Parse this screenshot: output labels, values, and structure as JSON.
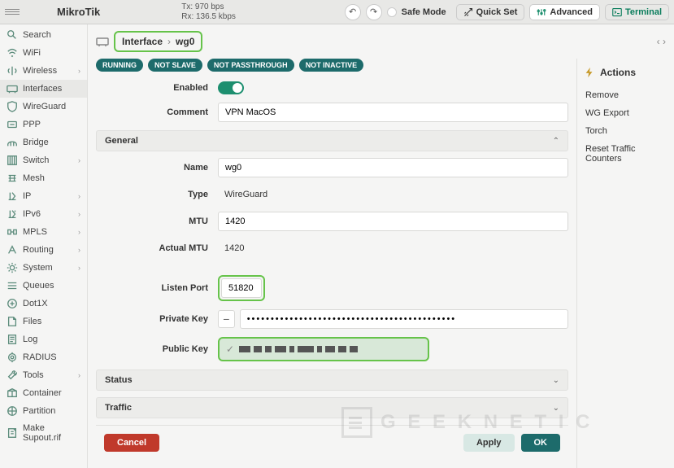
{
  "brand": "MikroTik",
  "stats": {
    "tx": "Tx: 970 bps",
    "rx": "Rx: 136.5 kbps"
  },
  "top": {
    "safemode": "Safe Mode",
    "quickset": "Quick Set",
    "advanced": "Advanced",
    "terminal": "Terminal"
  },
  "sidebar": [
    {
      "label": "Search",
      "icon": "search",
      "chev": false
    },
    {
      "label": "WiFi",
      "icon": "wifi",
      "chev": false
    },
    {
      "label": "Wireless",
      "icon": "wireless",
      "chev": true
    },
    {
      "label": "Interfaces",
      "icon": "interfaces",
      "chev": false,
      "sel": true
    },
    {
      "label": "WireGuard",
      "icon": "shield",
      "chev": false
    },
    {
      "label": "PPP",
      "icon": "ppp",
      "chev": false
    },
    {
      "label": "Bridge",
      "icon": "bridge",
      "chev": false
    },
    {
      "label": "Switch",
      "icon": "switch",
      "chev": true
    },
    {
      "label": "Mesh",
      "icon": "mesh",
      "chev": false
    },
    {
      "label": "IP",
      "icon": "ip",
      "chev": true
    },
    {
      "label": "IPv6",
      "icon": "ipv6",
      "chev": true
    },
    {
      "label": "MPLS",
      "icon": "mpls",
      "chev": true
    },
    {
      "label": "Routing",
      "icon": "routing",
      "chev": true
    },
    {
      "label": "System",
      "icon": "system",
      "chev": true
    },
    {
      "label": "Queues",
      "icon": "queues",
      "chev": false
    },
    {
      "label": "Dot1X",
      "icon": "dot1x",
      "chev": false
    },
    {
      "label": "Files",
      "icon": "files",
      "chev": false
    },
    {
      "label": "Log",
      "icon": "log",
      "chev": false
    },
    {
      "label": "RADIUS",
      "icon": "radius",
      "chev": false
    },
    {
      "label": "Tools",
      "icon": "tools",
      "chev": true
    },
    {
      "label": "Container",
      "icon": "container",
      "chev": false
    },
    {
      "label": "Partition",
      "icon": "partition",
      "chev": false
    },
    {
      "label": "Make Supout.rif",
      "icon": "supout",
      "chev": false
    }
  ],
  "breadcrumb": {
    "parent": "Interface",
    "current": "wg0"
  },
  "badges": [
    "RUNNING",
    "NOT SLAVE",
    "NOT PASSTHROUGH",
    "NOT INACTIVE"
  ],
  "fields": {
    "enabled_label": "Enabled",
    "comment_label": "Comment",
    "comment_value": "VPN MacOS",
    "name_label": "Name",
    "name_value": "wg0",
    "type_label": "Type",
    "type_value": "WireGuard",
    "mtu_label": "MTU",
    "mtu_value": "1420",
    "actual_mtu_label": "Actual MTU",
    "actual_mtu_value": "1420",
    "listen_port_label": "Listen Port",
    "listen_port_value": "51820",
    "private_key_label": "Private Key",
    "private_key_value": "••••••••••••••••••••••••••••••••••••••••••••",
    "public_key_label": "Public Key"
  },
  "sections": {
    "general": "General",
    "status": "Status",
    "traffic": "Traffic"
  },
  "actions": {
    "title": "Actions",
    "items": [
      "Remove",
      "WG Export",
      "Torch",
      "Reset Traffic Counters"
    ]
  },
  "footer": {
    "cancel": "Cancel",
    "apply": "Apply",
    "ok": "OK"
  },
  "watermark": "G E E K N E T I C"
}
